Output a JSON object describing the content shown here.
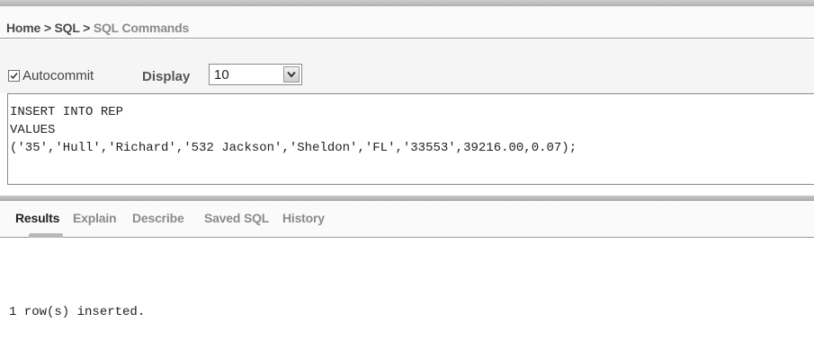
{
  "breadcrumb": {
    "items": [
      "Home",
      "SQL",
      "SQL Commands"
    ],
    "separator": ">"
  },
  "toolbar": {
    "autocommit_label": "Autocommit",
    "autocommit_checked": true,
    "display_label": "Display",
    "display_value": "10"
  },
  "editor": {
    "sql_text": "INSERT INTO REP\nVALUES\n('35','Hull','Richard','532 Jackson','Sheldon','FL','33553',39216.00,0.07);"
  },
  "tabs": {
    "items": [
      "Results",
      "Explain",
      "Describe",
      "Saved SQL",
      "History"
    ],
    "active": "Results"
  },
  "results": {
    "message": "1 row(s) inserted."
  }
}
